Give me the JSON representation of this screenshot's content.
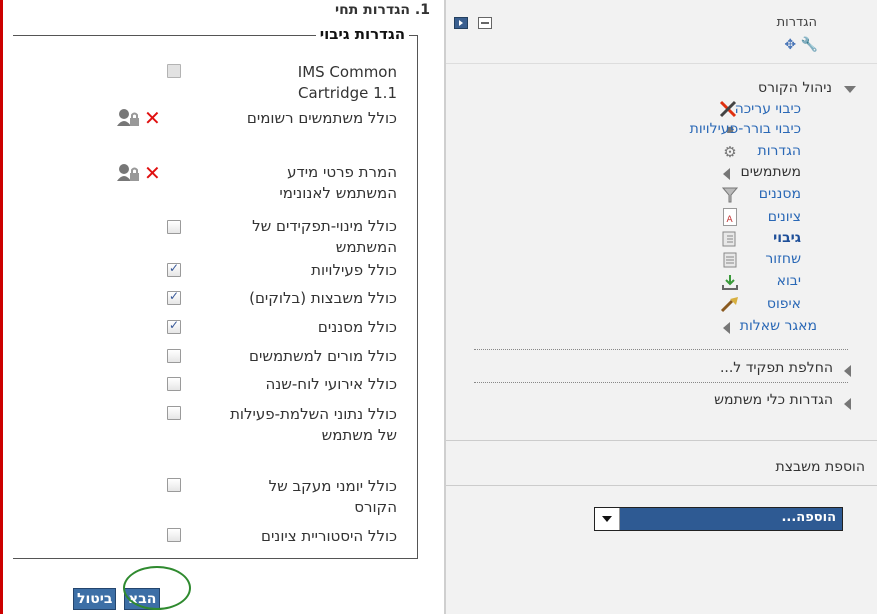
{
  "page": {
    "section_heading": "1. הגדרות תחי"
  },
  "backup_settings": {
    "legend": "הגדרות גיבוי",
    "options": [
      {
        "label": "IMS Common Cartridge 1.1",
        "checked": false,
        "enabled": false
      },
      {
        "label": "כולל משתמשים רשומים",
        "checked": false,
        "locked": true
      },
      {
        "label": "המרת פרטי מידע המשתמש לאנונימי",
        "checked": false,
        "locked": true
      },
      {
        "label": "כולל מינוי-תפקידים של המשתמש",
        "checked": false,
        "enabled": true
      },
      {
        "label": "כולל פעילויות",
        "checked": true
      },
      {
        "label": "כולל משבצות (בלוקים)",
        "checked": true
      },
      {
        "label": "כולל מסננים",
        "checked": true
      },
      {
        "label": "כולל מורים למשתמשים",
        "checked": false
      },
      {
        "label": "כולל אירועי לוח-שנה",
        "checked": false
      },
      {
        "label": "כולל נתוני השלמת-פעילות של משתמש",
        "checked": false
      },
      {
        "label": "כולל יומני מעקב של הקורס",
        "checked": false
      },
      {
        "label": "כולל היסטוריית ציונים",
        "checked": false
      }
    ]
  },
  "buttons": {
    "next_label": "הבא",
    "cancel_label": "ביטול"
  },
  "settings_block": {
    "title": "הגדרות",
    "course_admin_label": "ניהול הקורס",
    "items": [
      {
        "label": "כיבוי עריכה",
        "icon": "tools-icon"
      },
      {
        "label": "כיבוי בורר-פעילויות",
        "icon": "bullet-icon"
      },
      {
        "label": "הגדרות",
        "icon": "gear-icon"
      },
      {
        "label": "משתמשים",
        "icon": "expand-arrow-icon"
      },
      {
        "label": "מסננים",
        "icon": "filter-icon"
      },
      {
        "label": "ציונים",
        "icon": "grades-icon"
      },
      {
        "label": "גיבוי",
        "icon": "backup-icon",
        "active": true
      },
      {
        "label": "שחזור",
        "icon": "restore-icon"
      },
      {
        "label": "יבוא",
        "icon": "import-icon"
      },
      {
        "label": "איפוס",
        "icon": "reset-icon"
      },
      {
        "label": "מאגר שאלות",
        "icon": "expand-arrow-icon"
      }
    ],
    "switch_role_label": "החלפת תפקיד ל...",
    "user_settings_label": "הגדרות כלי משתמש"
  },
  "add_block": {
    "title": "הוספת משבצת",
    "select_value": "הוספה..."
  },
  "colors": {
    "accent_red": "#cc0000",
    "link_blue": "#2a68b6",
    "button_blue": "#3d6fa6",
    "circle_green": "#2f8a2f"
  }
}
